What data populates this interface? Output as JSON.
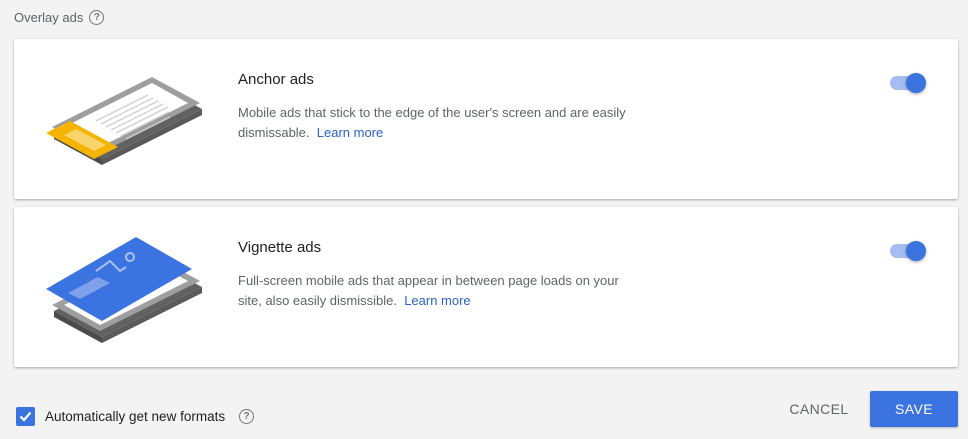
{
  "section": {
    "title": "Overlay ads",
    "help_icon": "help-circle-icon"
  },
  "cards": [
    {
      "title": "Anchor ads",
      "description": "Mobile ads that stick to the edge of the user's screen and are easily dismissable.",
      "link": "Learn more",
      "enabled": true
    },
    {
      "title": "Vignette ads",
      "description": "Full-screen mobile ads that appear in between page loads on your site, also easily dismissible.",
      "link": "Learn more",
      "enabled": true
    }
  ],
  "footer": {
    "checkbox_label": "Automatically get new formats",
    "checkbox_checked": true,
    "cancel_label": "CANCEL",
    "save_label": "SAVE"
  },
  "colors": {
    "accent": "#3b73e0",
    "toggle_track": "#a5bdf0",
    "anchor_ad": "#f4b400",
    "link": "#2b64c6"
  }
}
